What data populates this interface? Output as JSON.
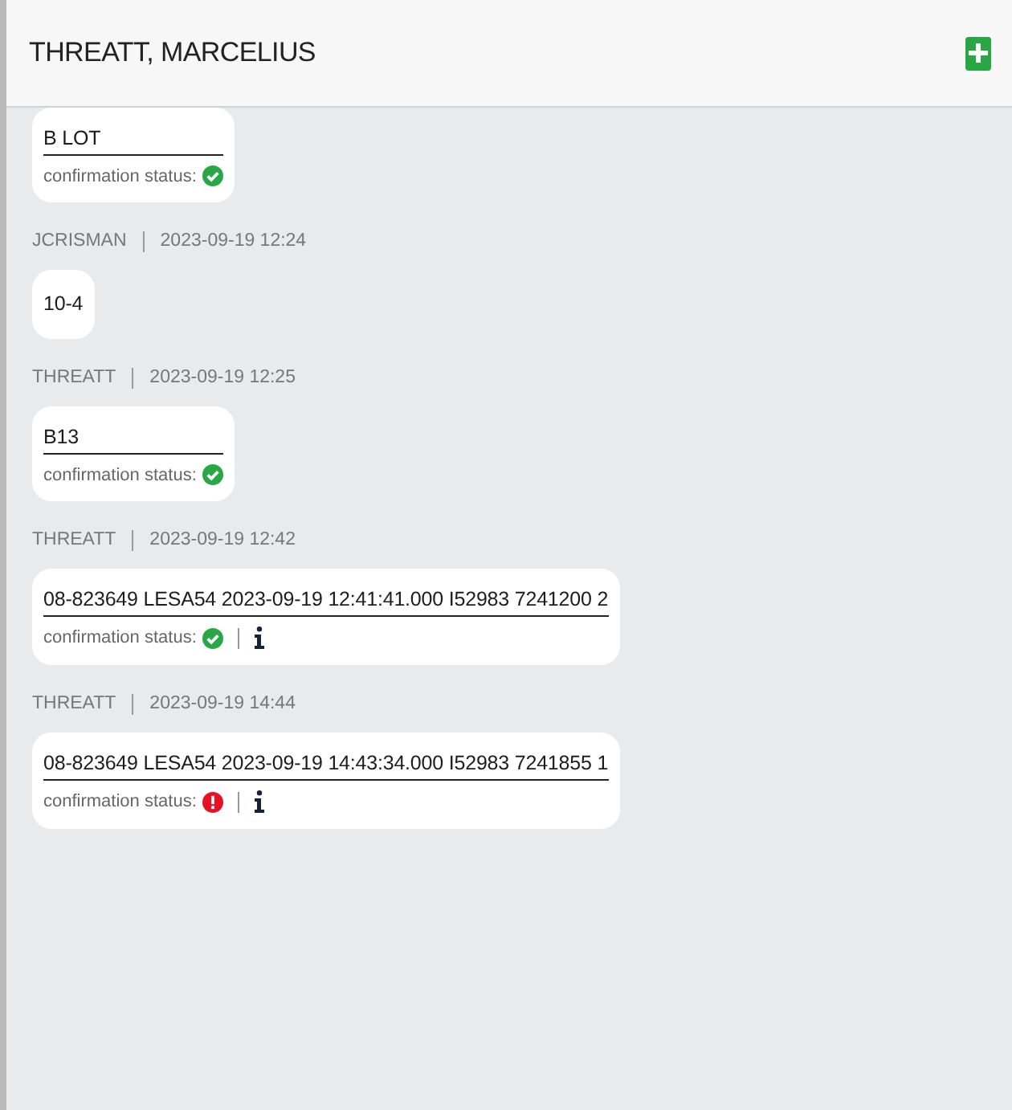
{
  "header": {
    "title": "THREATT, MARCELIUS"
  },
  "messages": [
    {
      "kind": "confirmation",
      "text": "B LOT",
      "status_label": "confirmation status:",
      "confirmed": true,
      "info": false
    },
    {
      "kind": "plain",
      "author": "JCRISMAN",
      "time": "2023-09-19 12:24",
      "text": "10-4"
    },
    {
      "kind": "confirmation",
      "author": "THREATT",
      "time": "2023-09-19 12:25",
      "text": "B13",
      "status_label": "confirmation status:",
      "confirmed": true,
      "info": false
    },
    {
      "kind": "confirmation",
      "author": "THREATT",
      "time": "2023-09-19 12:42",
      "text": "08-823649 LESA54 2023-09-19 12:41:41.000 I52983 7241200 2",
      "status_label": "confirmation status:",
      "confirmed": true,
      "info": true
    },
    {
      "kind": "confirmation",
      "author": "THREATT",
      "time": "2023-09-19 14:44",
      "text": "08-823649 LESA54 2023-09-19 14:43:34.000 I52983 7241855 1",
      "status_label": "confirmation status:",
      "confirmed": false,
      "info": true
    }
  ]
}
